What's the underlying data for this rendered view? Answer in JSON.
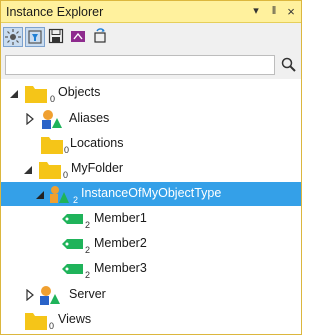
{
  "window": {
    "title": "Instance Explorer",
    "pin_glyph": "‖",
    "close_glyph": "×",
    "menu_glyph": "▾"
  },
  "search": {
    "value": "",
    "placeholder": ""
  },
  "tree": {
    "objects": {
      "label": "Objects",
      "count": "0"
    },
    "aliases": {
      "label": "Aliases"
    },
    "locations": {
      "label": "Locations",
      "count": "0"
    },
    "my_folder": {
      "label": "MyFolder",
      "count": "0"
    },
    "instance": {
      "label": "InstanceOfMyObjectType",
      "count": "2"
    },
    "members": [
      {
        "label": "Member1",
        "count": "2"
      },
      {
        "label": "Member2",
        "count": "2"
      },
      {
        "label": "Member3",
        "count": "2"
      }
    ],
    "server": {
      "label": "Server"
    },
    "views": {
      "label": "Views",
      "count": "0"
    }
  },
  "colors": {
    "title_bar": "#fff19d",
    "selection": "#34a0e8",
    "folder": "#f5c518",
    "member_tag": "#1fb35a"
  }
}
